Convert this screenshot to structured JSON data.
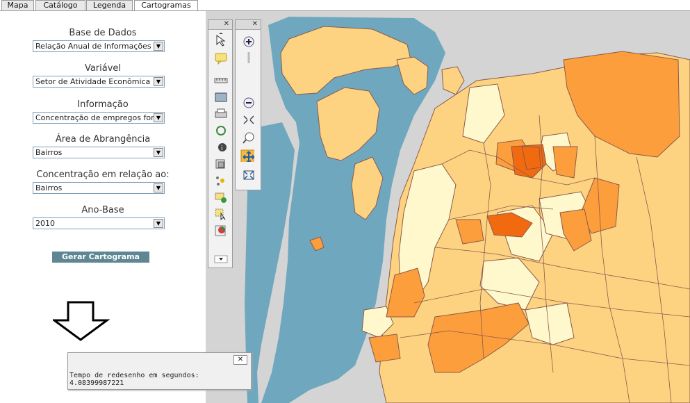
{
  "tabs": [
    {
      "label": "Mapa"
    },
    {
      "label": "Catálogo"
    },
    {
      "label": "Legenda"
    },
    {
      "label": "Cartogramas"
    }
  ],
  "form": {
    "base_label": "Base de Dados",
    "base_value": "Relação Anual de Informações Sociais",
    "variavel_label": "Variável",
    "variavel_value": "Setor de Atividade Econômica",
    "informacao_label": "Informação",
    "informacao_value": "Concentração de empregos formais",
    "area_label": "Área de Abrangência",
    "area_value": "Bairros",
    "concentracao_label": "Concentração em relação ao:",
    "concentracao_value": "Bairros",
    "ano_label": "Ano-Base",
    "ano_value": "2010",
    "submit_label": "Gerar Cartograma"
  },
  "popup": {
    "close_label": "✕",
    "message_line1": "Tempo de redesenho em segundos:",
    "message_line2": "4.08399987221"
  },
  "colors": {
    "water": "#6fa8be",
    "background": "#d4d4d4",
    "class_lowest": "#fff8cc",
    "class_low": "#fdd382",
    "class_mid": "#fd9e3c",
    "class_high": "#f26a10",
    "button": "#5f8793"
  },
  "icons": {
    "close": "close-icon",
    "down_arrow": "down-arrow-icon"
  }
}
